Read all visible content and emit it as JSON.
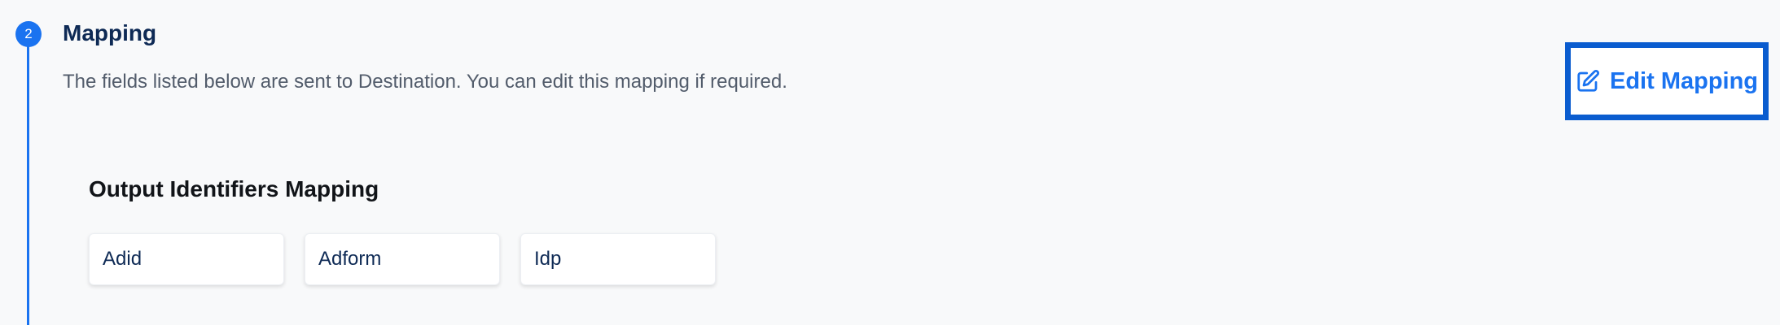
{
  "step": {
    "number": "2",
    "title": "Mapping",
    "description": "The fields listed below are sent to Destination. You can edit this mapping if required."
  },
  "edit_button": {
    "label": "Edit Mapping",
    "icon": "edit-icon"
  },
  "output_identifiers": {
    "title": "Output Identifiers Mapping",
    "items": [
      {
        "label": "Adid"
      },
      {
        "label": "Adform"
      },
      {
        "label": "Idp"
      }
    ]
  },
  "colors": {
    "accent": "#1a73f0",
    "focus_border": "#0a5ccf",
    "title_text": "#0e2a55",
    "description_text": "#525c6b",
    "background": "#f8f9fa"
  }
}
